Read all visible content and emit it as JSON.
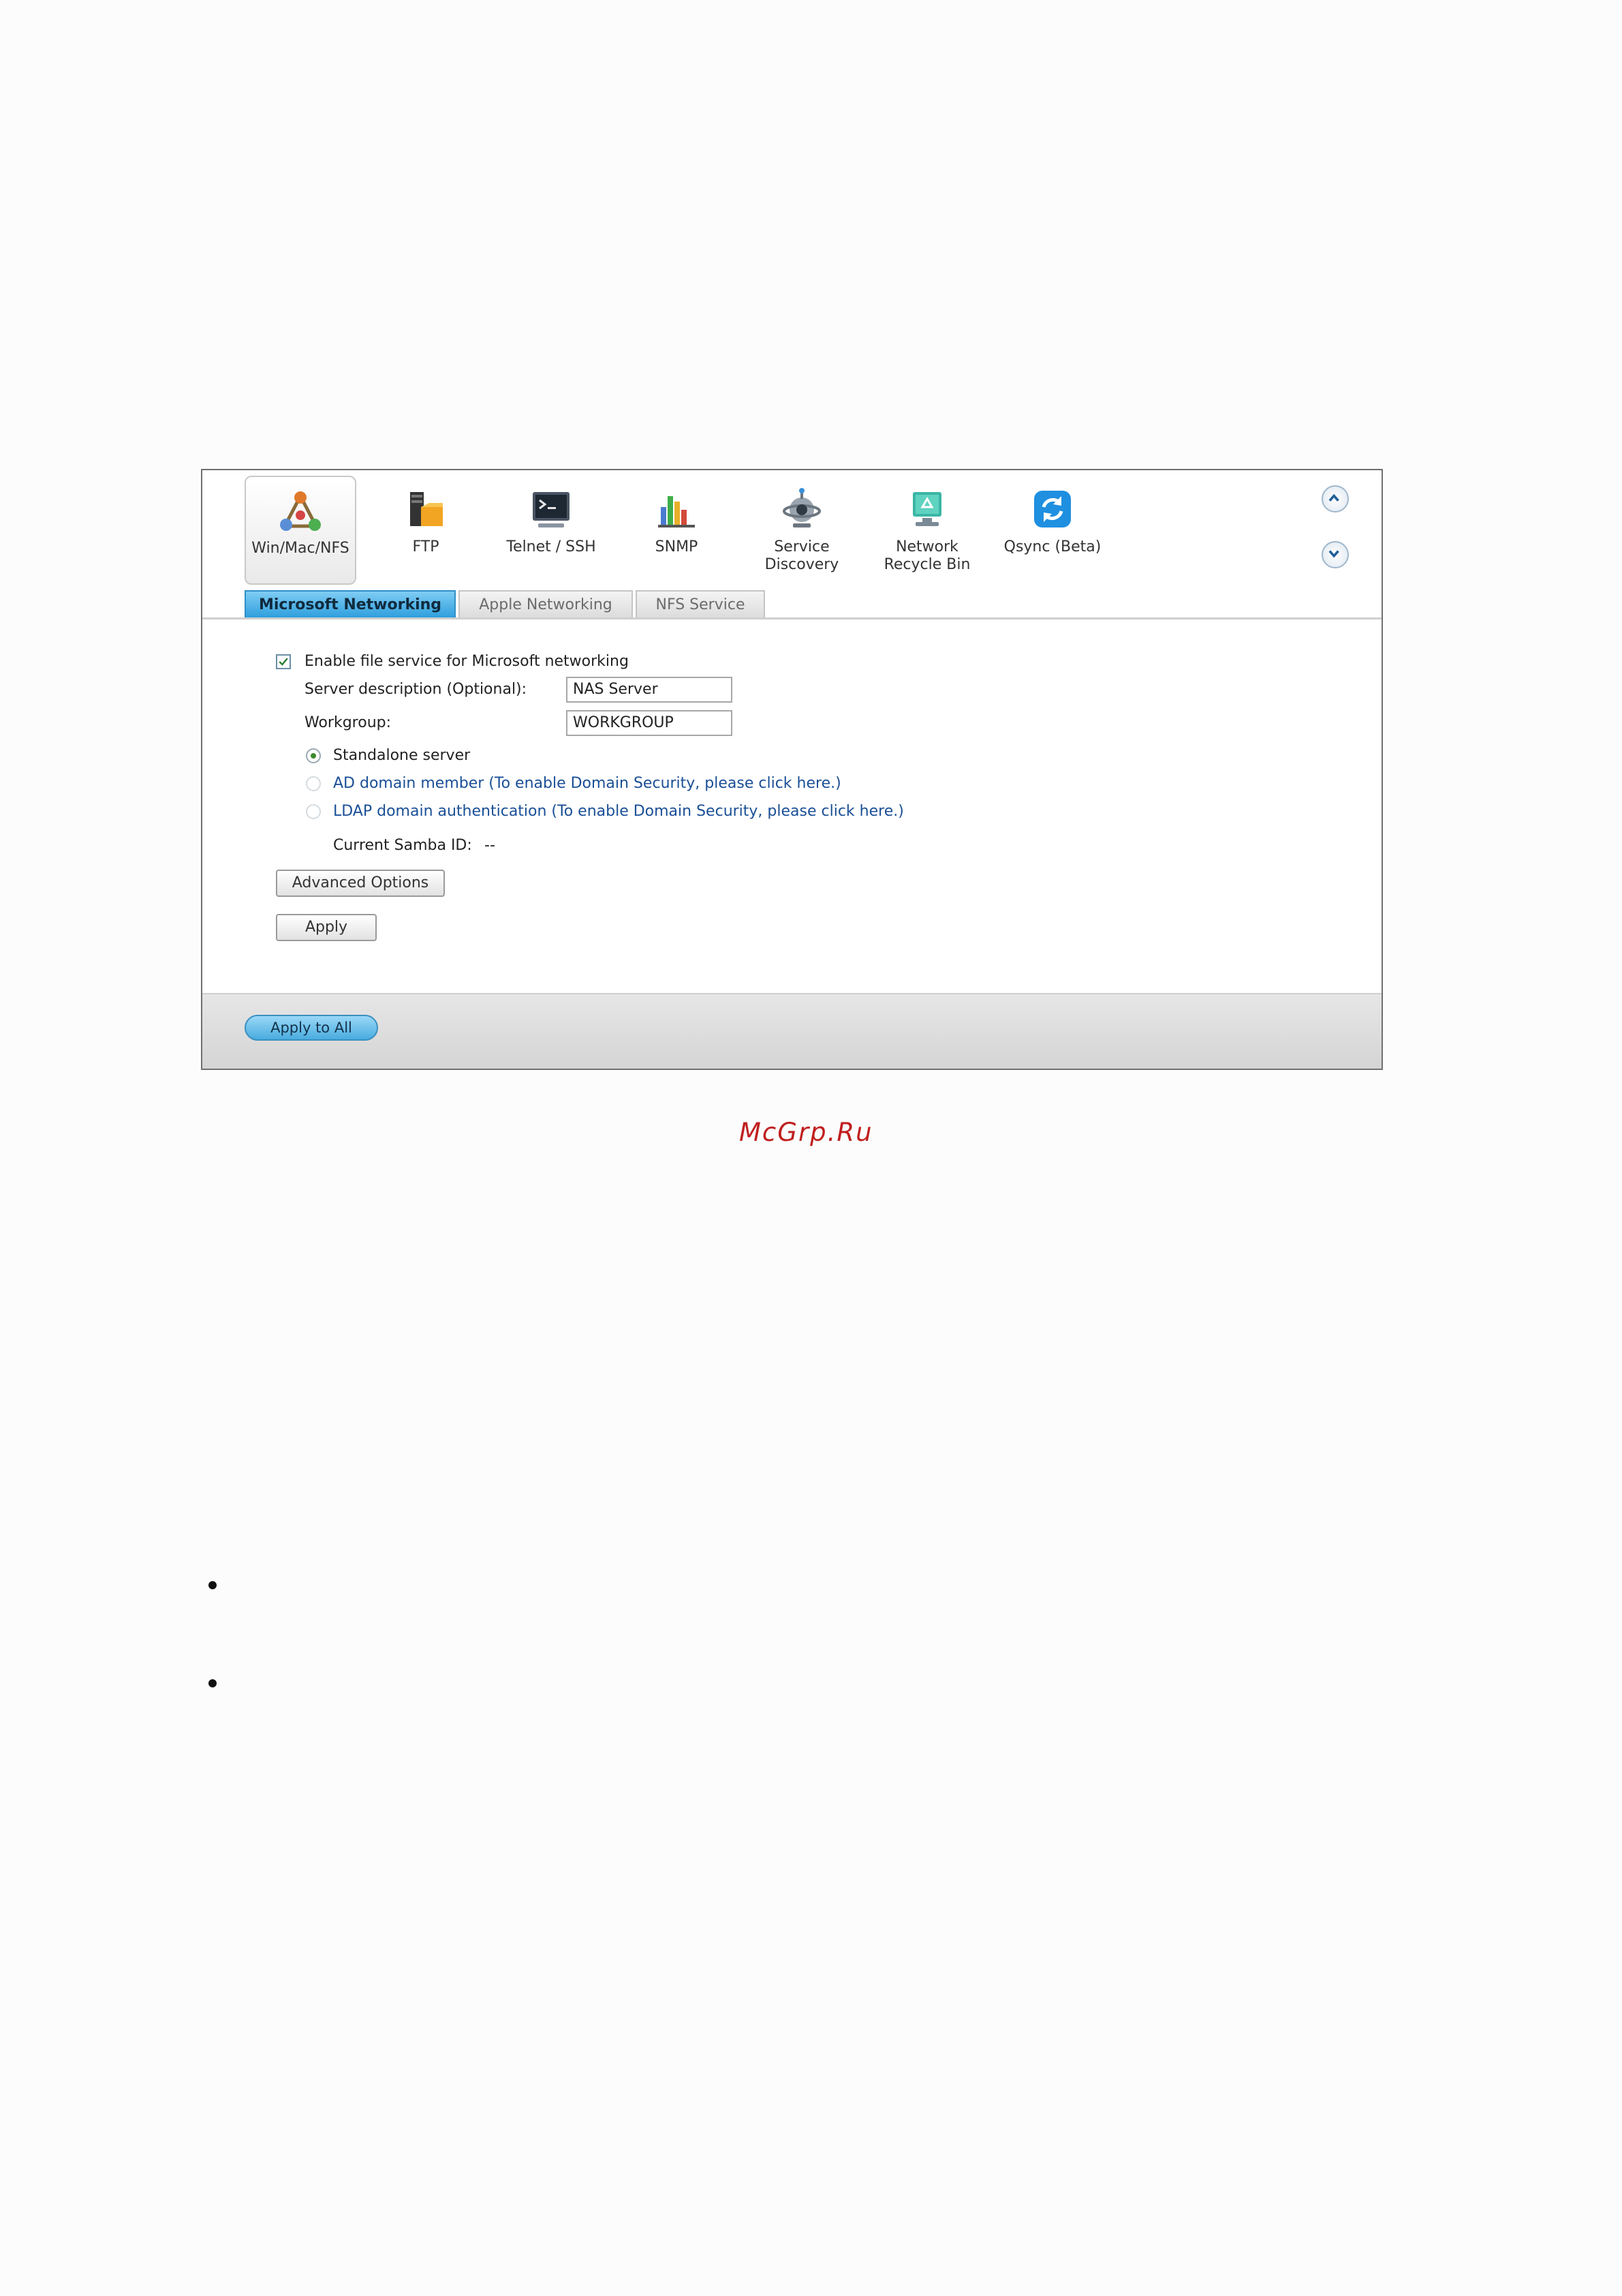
{
  "toolbar": {
    "services": [
      {
        "label": "Win/Mac/NFS",
        "icon": "win-mac-nfs-icon"
      },
      {
        "label": "FTP",
        "icon": "ftp-icon"
      },
      {
        "label": "Telnet / SSH",
        "icon": "terminal-icon"
      },
      {
        "label": "SNMP",
        "icon": "snmp-chart-icon"
      },
      {
        "label": "Service\nDiscovery",
        "icon": "service-discovery-icon"
      },
      {
        "label": "Network\nRecycle Bin",
        "icon": "recycle-bin-icon"
      },
      {
        "label": "Qsync (Beta)",
        "icon": "qsync-icon"
      }
    ],
    "scroll_up_icon": "chevron-up-icon",
    "scroll_down_icon": "chevron-down-icon"
  },
  "tabs": [
    {
      "label": "Microsoft Networking",
      "active": true
    },
    {
      "label": "Apple Networking",
      "active": false
    },
    {
      "label": "NFS Service",
      "active": false
    }
  ],
  "form": {
    "enable_label": "Enable file service for Microsoft networking",
    "enable_checked": true,
    "server_desc_label": "Server description (Optional):",
    "server_desc_value": "NAS Server",
    "workgroup_label": "Workgroup:",
    "workgroup_value": "WORKGROUP",
    "radio_options": [
      {
        "label": "Standalone server",
        "selected": true
      },
      {
        "label": "AD domain member (To enable Domain Security, please click here.)",
        "selected": false
      },
      {
        "label": "LDAP domain authentication (To enable Domain Security, please click here.)",
        "selected": false
      }
    ],
    "samba_id_label": "Current Samba ID:",
    "samba_id_value": "--",
    "advanced_button": "Advanced Options",
    "apply_button": "Apply"
  },
  "footer": {
    "apply_all_button": "Apply to All"
  },
  "watermark": "McGrp.Ru",
  "colors": {
    "accent": "#2f9fdd",
    "link": "#1a4f96",
    "watermark": "#c01e1e"
  }
}
